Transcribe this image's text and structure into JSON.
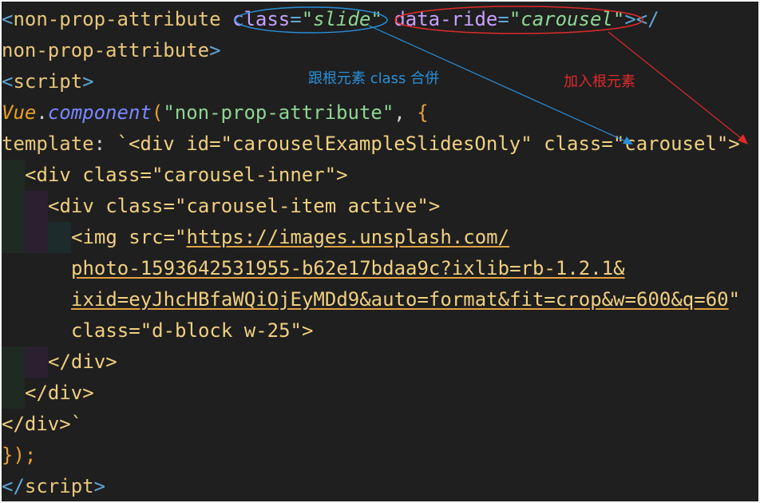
{
  "code": {
    "l1": {
      "open": "<",
      "tag": "non-prop-attribute",
      "attr1": "class",
      "eq1": "=",
      "val1": "\"slide\"",
      "attr2": "data-ride",
      "eq2": "=",
      "val2": "\"carousel\"",
      "close": "></"
    },
    "l2": {
      "tag": "non-prop-attribute",
      "close": ">"
    },
    "l3": {
      "open": "<",
      "tag": "script",
      "close": ">"
    },
    "l4": {
      "obj": "Vue",
      "dot": ".",
      "method": "component",
      "paren": "(",
      "name": "\"non-prop-attribute\"",
      "comma": ", ",
      "brace": "{"
    },
    "l5": {
      "key": "template",
      "colon": ": ",
      "text": "`<div id=\"carouselExampleSlidesOnly\" class=\"carousel\">"
    },
    "l6": {
      "text": "<div class=\"carousel-inner\">"
    },
    "l7": {
      "text": "<div class=\"carousel-item active\">"
    },
    "l8": {
      "pre": "<img src=\"",
      "url": "https://images.unsplash.com/"
    },
    "l9": {
      "url": "photo-1593642531955-b62e17bdaa9c?ixlib=rb-1.2.1&"
    },
    "l10": {
      "url": "ixid=eyJhcHBfaWQiOjEyMDd9&auto=format&fit=crop&w=600&q=60",
      "post": "\""
    },
    "l11": {
      "text": "class=\"d-block w-25\">"
    },
    "l12": {
      "text": "</div>"
    },
    "l13": {
      "text": "</div>"
    },
    "l14": {
      "text": "</div>`"
    },
    "l15": {
      "text": "});"
    },
    "l16": {
      "open": "</",
      "tag": "script",
      "close": ">"
    }
  },
  "annotations": {
    "merge_label": "跟根元素 class 合併",
    "add_label": "加入根元素",
    "merge_color": "#2a8fd8",
    "add_color": "#e02a2a"
  },
  "colors": {
    "background": "#1f1f1f",
    "tag_bracket": "#5fa8d6",
    "tag_name": "#e8c77a",
    "attribute": "#c9a0ff",
    "string": "#8fd694",
    "url_underline": "#e0a040"
  }
}
